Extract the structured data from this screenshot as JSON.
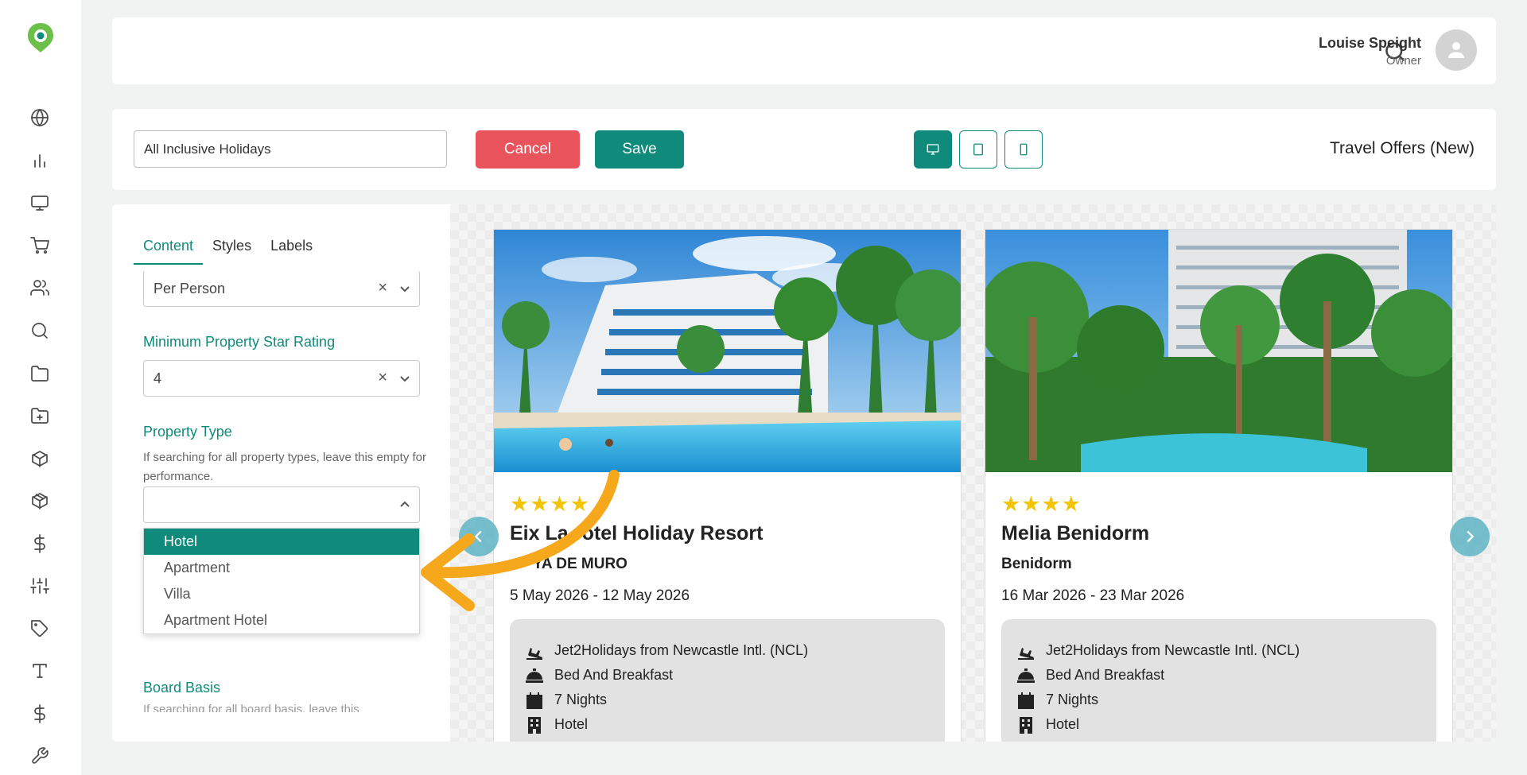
{
  "header": {
    "user_name": "Louise Speight",
    "user_role": "Owner"
  },
  "toolbar": {
    "name_value": "All Inclusive Holidays",
    "cancel_label": "Cancel",
    "save_label": "Save",
    "title": "Travel Offers (New)",
    "devices": [
      "desktop",
      "tablet",
      "mobile"
    ],
    "active_device": "desktop"
  },
  "panel": {
    "tabs": [
      "Content",
      "Styles",
      "Labels"
    ],
    "active_tab": "Content",
    "price_basis": "Per Person",
    "star_rating_label": "Minimum Property Star Rating",
    "star_rating_value": "4",
    "property_type_label": "Property Type",
    "property_type_help": "If searching for all property types, leave this empty for performance.",
    "property_type_options": [
      "Hotel",
      "Apartment",
      "Villa",
      "Apartment Hotel"
    ],
    "property_type_highlighted": "Hotel",
    "board_basis_label": "Board Basis",
    "board_basis_help": "If searching for all board basis, leave this"
  },
  "cards": [
    {
      "stars": 4,
      "name": "Eix Lagotel Holiday Resort",
      "name_visible": "Eix La",
      "name_visible_end": "otel Holiday Resort",
      "resort": "PLAYA DE MURO",
      "resort_visible": "YA DE MURO",
      "dates": "5 May 2026 - 12 May 2026",
      "details": [
        "Jet2Holidays from Newcastle Intl. (NCL)",
        "Bed And Breakfast",
        "7 Nights",
        "Hotel"
      ]
    },
    {
      "stars": 4,
      "name": "Melia Benidorm",
      "resort": "Benidorm",
      "dates": "16 Mar 2026 - 23 Mar 2026",
      "details": [
        "Jet2Holidays from Newcastle Intl. (NCL)",
        "Bed And Breakfast",
        "7 Nights",
        "Hotel"
      ]
    }
  ],
  "sidebar": {
    "icons": [
      "globe-icon",
      "bar-chart-icon",
      "monitor-icon",
      "cart-icon",
      "users-icon",
      "search-icon",
      "folder-icon",
      "folder-plus-icon",
      "box-icon",
      "package-icon",
      "dollar-icon",
      "sliders-icon",
      "tag-icon",
      "type-icon",
      "dollar-icon",
      "wrench-icon"
    ]
  },
  "colors": {
    "accent": "#0f8a7b",
    "danger": "#e9545c",
    "star": "#f5c400",
    "annotation_arrow": "#f5a81c"
  }
}
